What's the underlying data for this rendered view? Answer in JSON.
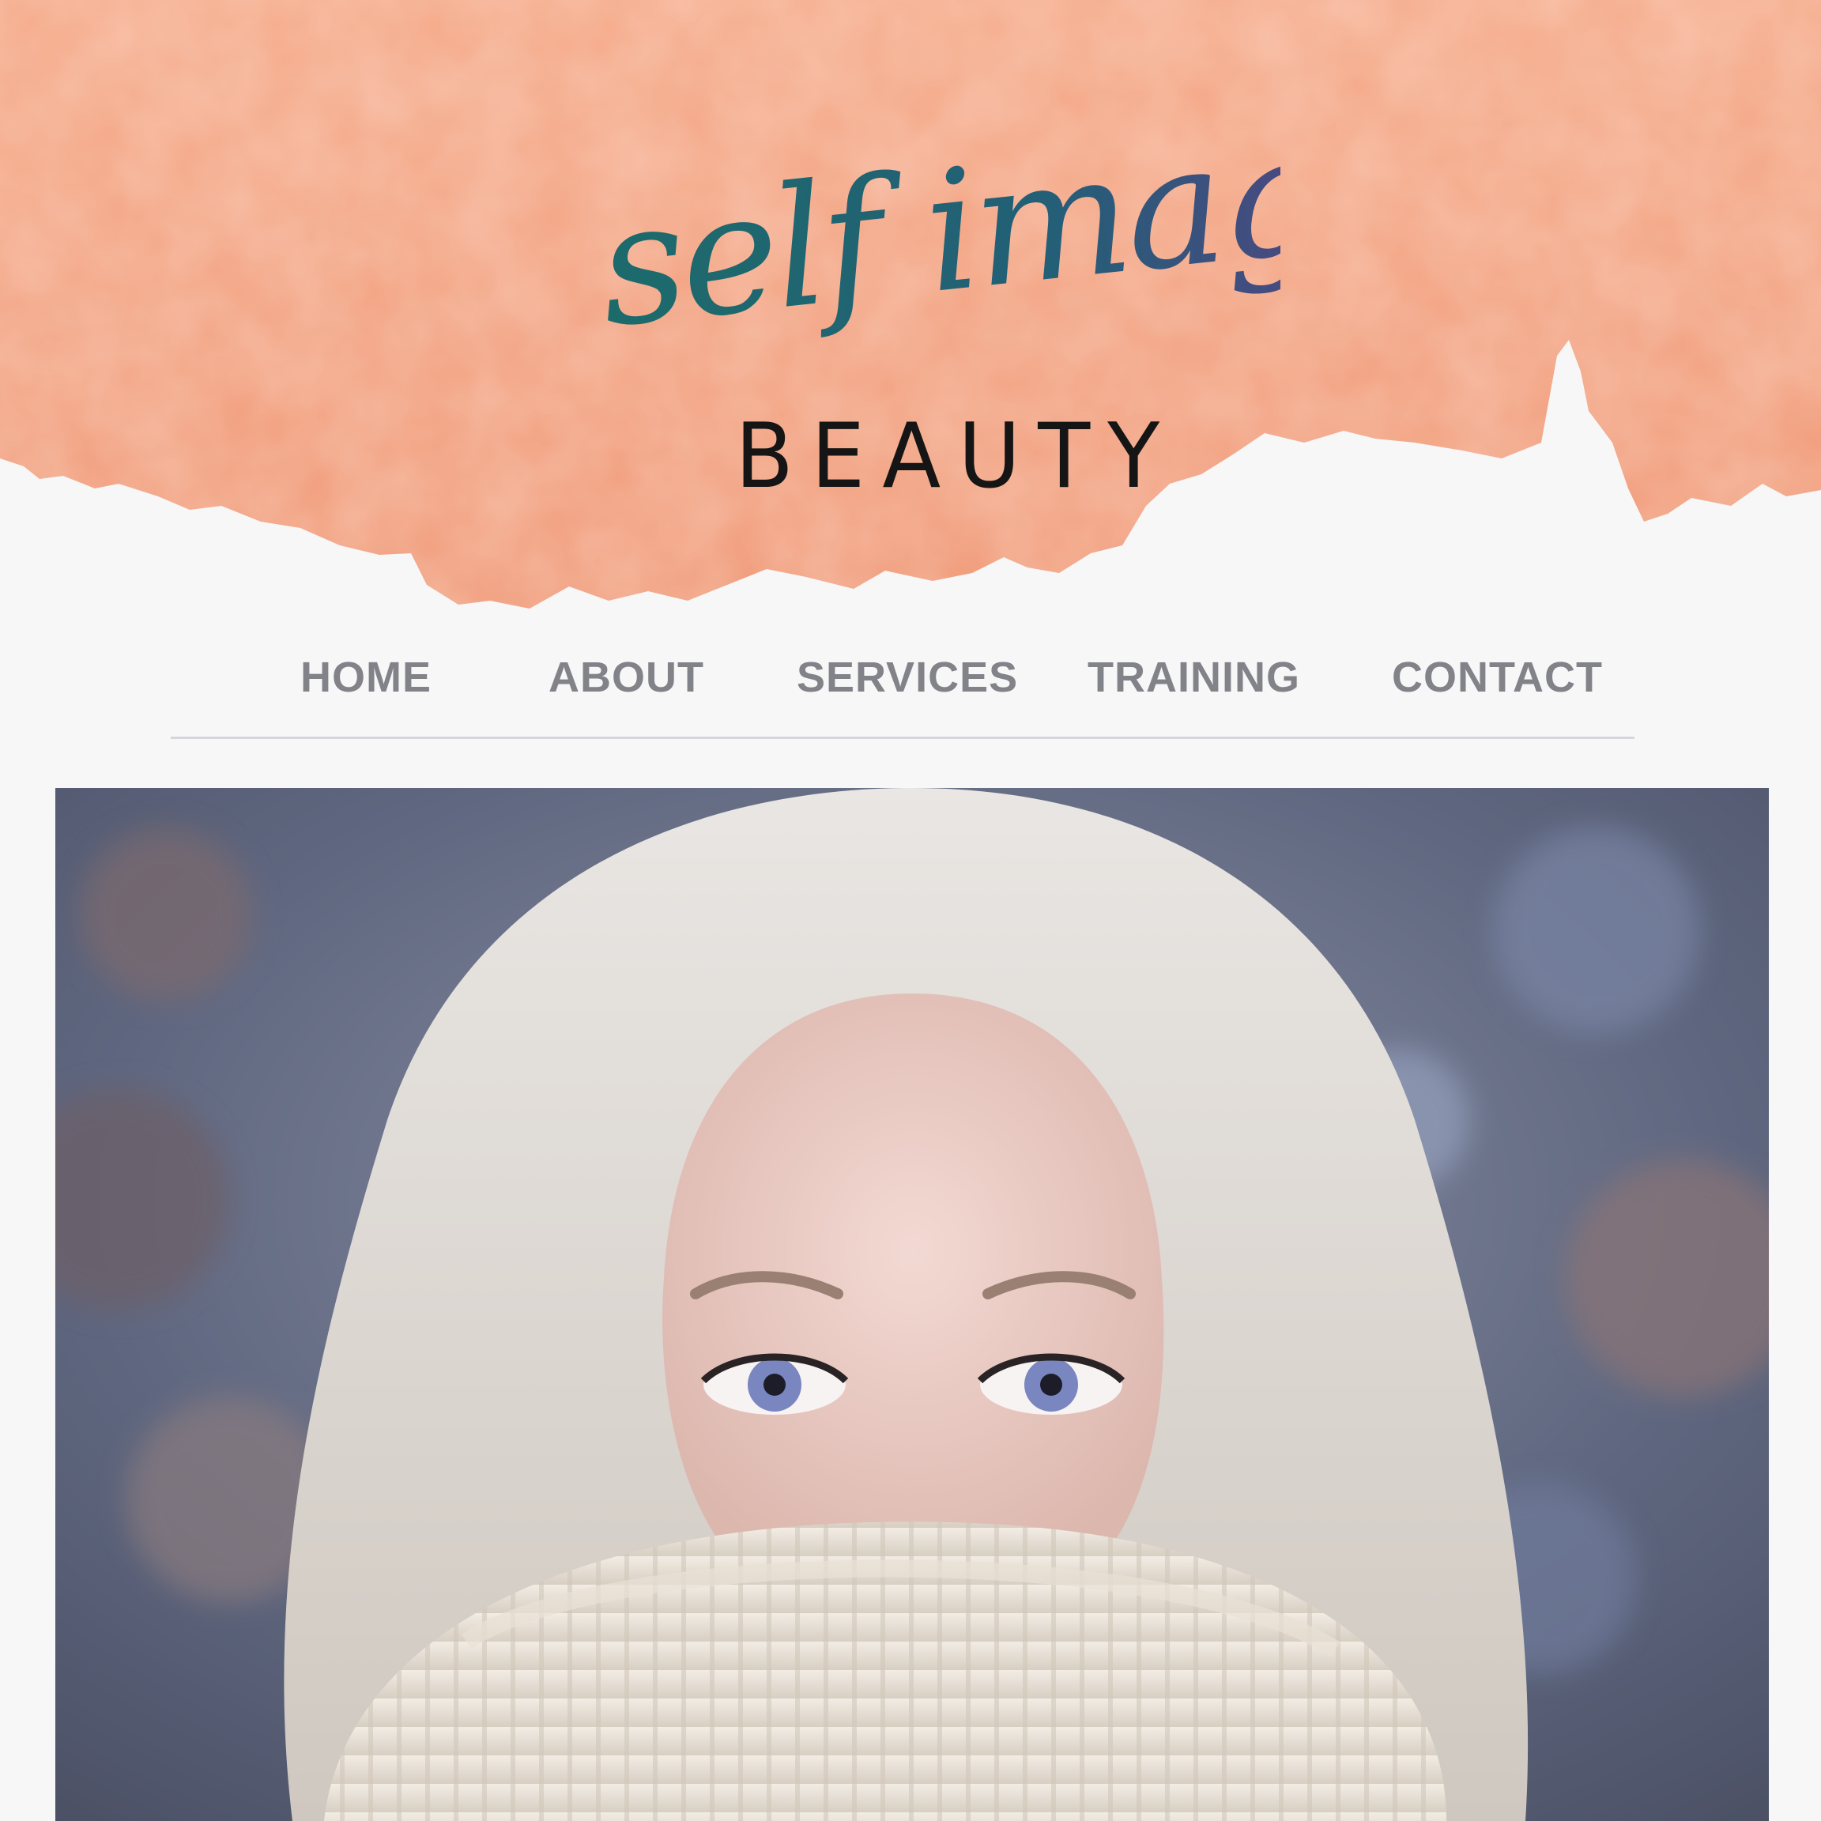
{
  "brand": {
    "script_text": "self image",
    "word_text": "BEAUTY",
    "colors": {
      "watercolor": "#f2a17f",
      "script_start": "#1c6b6b",
      "script_end": "#5a3f86",
      "word": "#151515"
    }
  },
  "nav": {
    "items": [
      {
        "label": "HOME"
      },
      {
        "label": "ABOUT"
      },
      {
        "label": "SERVICES"
      },
      {
        "label": "TRAINING"
      },
      {
        "label": "CONTACT"
      }
    ],
    "text_color": "#828289",
    "divider_color": "#d6d6da"
  },
  "hero": {
    "image": "woman-in-knit-sweater-photo"
  }
}
